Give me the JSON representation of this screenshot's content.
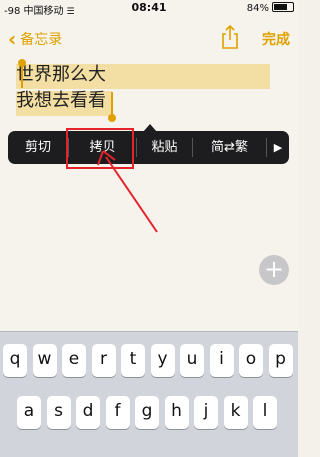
{
  "status_bar": {
    "signal": "-98 中国移动",
    "wifi_icon": "wifi-icon",
    "time": "08:41",
    "battery": "84%",
    "battery_level": 0.84
  },
  "nav": {
    "back_label": "备忘录",
    "share_icon": "share-icon",
    "done_label": "完成"
  },
  "note": {
    "lines": [
      "世界那么大",
      "我想去看看"
    ]
  },
  "context_menu": {
    "items": [
      "剪切",
      "拷贝",
      "粘贴",
      "简⇄繁"
    ],
    "more_icon": "▶"
  },
  "plus_icon": "+",
  "keyboard": {
    "row1": [
      "q",
      "w",
      "e",
      "r",
      "t",
      "y",
      "u",
      "i",
      "o",
      "p"
    ],
    "row2": [
      "a",
      "s",
      "d",
      "f",
      "g",
      "h",
      "j",
      "k",
      "l"
    ]
  },
  "colors": {
    "accent": "#e0a100",
    "selection": "#f3dfa3",
    "annotation": "#e5232a",
    "menu_bg": "#1d1d1f"
  }
}
